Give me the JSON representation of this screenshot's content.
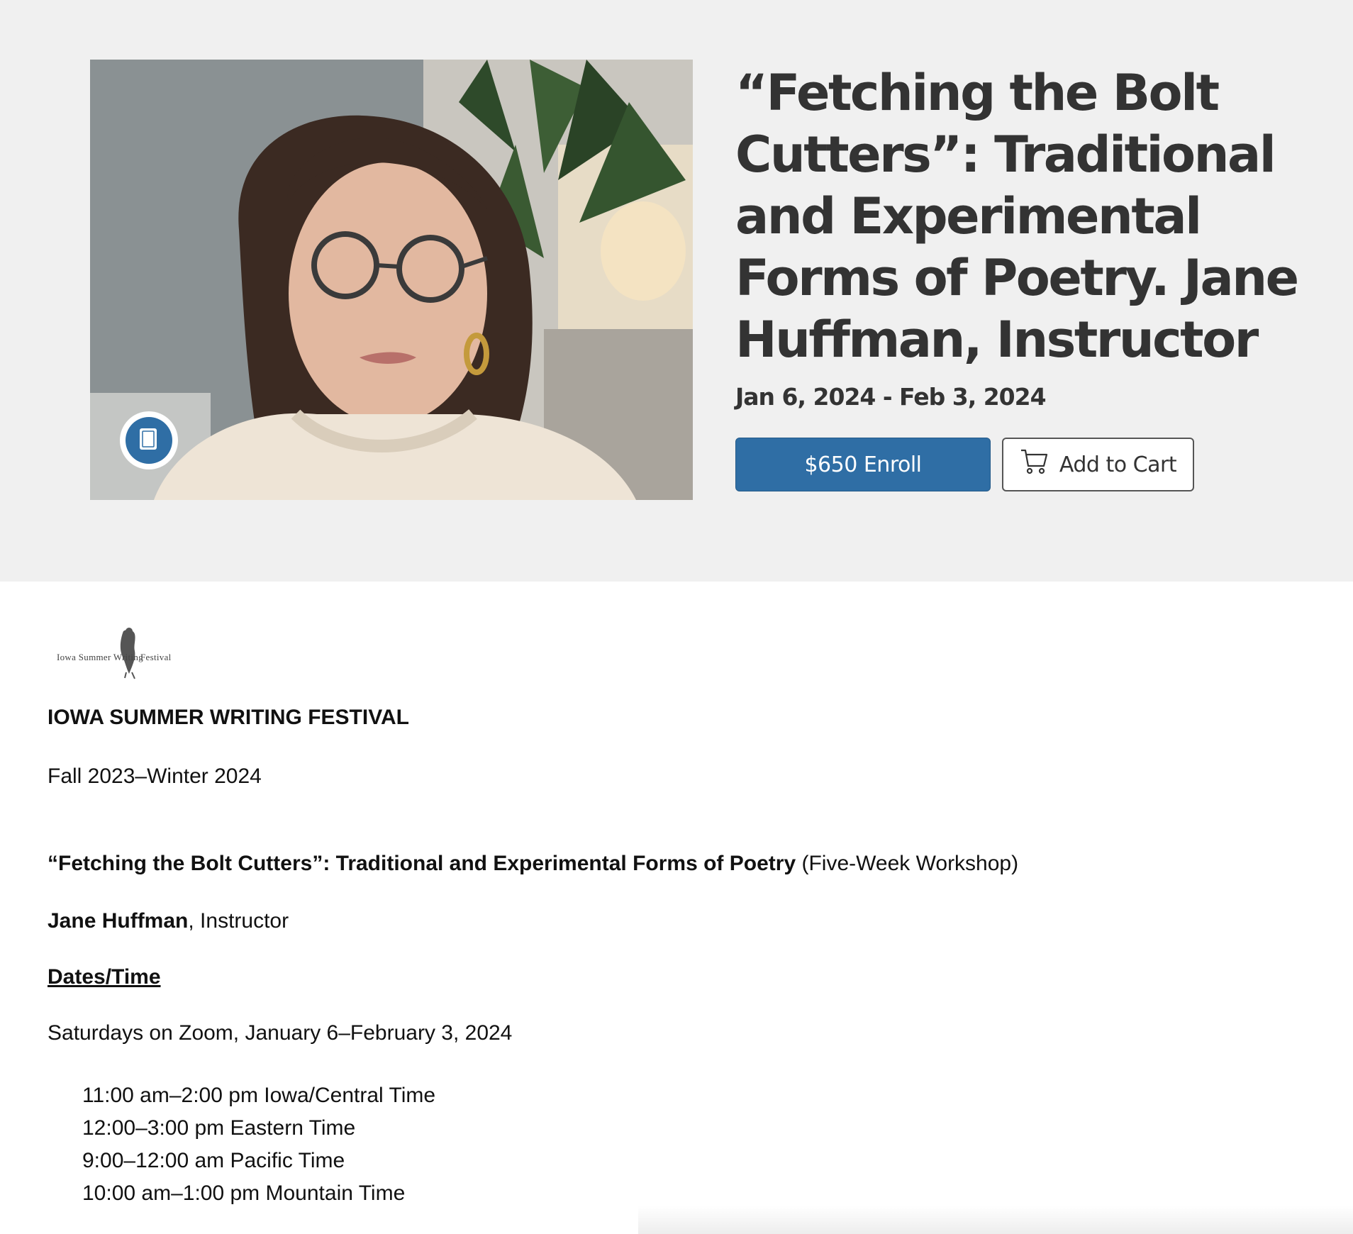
{
  "hero": {
    "title": "“Fetching the Bolt Cutters”: Traditional and Experimental Forms of Poetry. Jane Huffman, Instructor",
    "dates": "Jan 6, 2024 - Feb 3, 2024",
    "enroll_label": "$650 Enroll",
    "cart_label": "Add to Cart",
    "course_icon": "book-icon",
    "cart_icon": "cart-icon"
  },
  "content": {
    "logo_words": [
      "Iowa Summer Writing",
      "Festival"
    ],
    "org_heading": "IOWA SUMMER WRITING FESTIVAL",
    "term": "Fall 2023–Winter 2024",
    "course_title": "“Fetching the Bolt Cutters”: Traditional and Experimental Forms of Poetry",
    "course_format": " (Five-Week Workshop)",
    "instructor_name": "Jane Huffman",
    "instructor_role": ", Instructor",
    "dates_heading": "Dates/Time",
    "schedule": "Saturdays on Zoom, January 6–February 3, 2024",
    "times": [
      "11:00 am–2:00 pm Iowa/Central Time",
      "12:00–3:00 pm Eastern Time",
      "9:00–12:00 am Pacific Time",
      "10:00 am–1:00 pm Mountain Time"
    ]
  },
  "colors": {
    "hero_background": "#f0f0f0",
    "primary_button": "#2f6ea5",
    "heading_text": "#333333"
  }
}
